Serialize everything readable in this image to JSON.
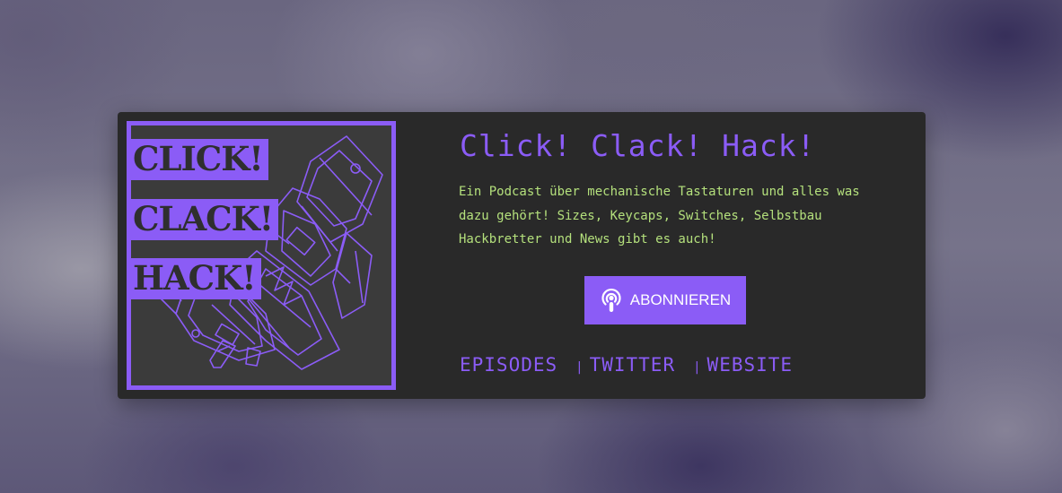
{
  "cover": {
    "words": [
      "CLICK!",
      "CLACK!",
      "HACK!"
    ],
    "art_icon": "keyboard-switch-exploded-icon"
  },
  "podcast": {
    "title": "Click! Clack! Hack!",
    "description": "Ein Podcast über mechanische Tastaturen und alles was dazu gehört! Sizes, Keycaps, Switches, Selbstbau Hackbretter und News gibt es auch!"
  },
  "subscribe": {
    "label": "ABONNIEREN",
    "icon": "podcast-icon"
  },
  "links": [
    {
      "label": "EPISODES"
    },
    {
      "label": "TWITTER"
    },
    {
      "label": "WEBSITE"
    }
  ],
  "separator": "|",
  "colors": {
    "accent": "#8b5cf6",
    "text_green": "#b4e07c",
    "card_bg": "#292929",
    "cover_bg": "#3b3b3b"
  }
}
